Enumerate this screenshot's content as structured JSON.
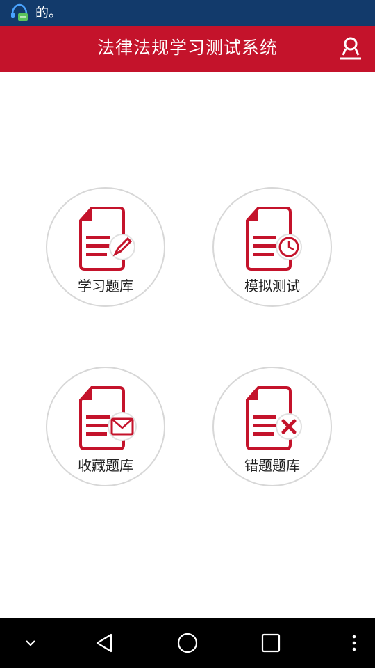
{
  "status_bar": {
    "notification_text": "的。",
    "notification_icon": "chat-bubble-icon"
  },
  "app_bar": {
    "title": "法律法规学习测试系统",
    "user_icon": "user-icon"
  },
  "tiles": [
    {
      "label": "学习题库",
      "icon": "document-pencil-icon"
    },
    {
      "label": "模拟测试",
      "icon": "document-clock-icon"
    },
    {
      "label": "收藏题库",
      "icon": "document-envelope-icon"
    },
    {
      "label": "错题题库",
      "icon": "document-cross-icon"
    }
  ],
  "nav_bar": {
    "icons": [
      "chevron-down-icon",
      "back-icon",
      "home-icon",
      "recents-icon",
      "overflow-menu-icon"
    ]
  },
  "colors": {
    "status_bar": "#123a6b",
    "app_bar": "#c4132b",
    "icon_red": "#c4132b"
  }
}
